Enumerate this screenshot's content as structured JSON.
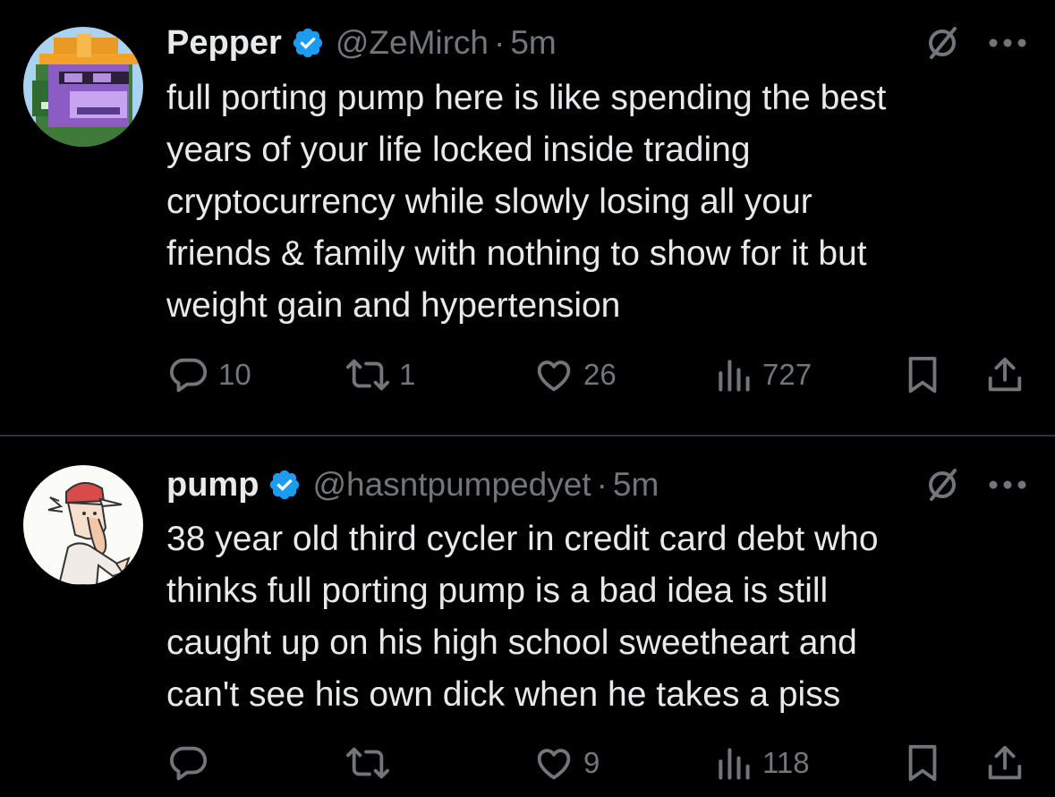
{
  "colors": {
    "background": "#000000",
    "text_primary": "#e7e9ea",
    "text_secondary": "#71767b",
    "verified_badge": "#1d9bf0",
    "divider": "#2f3336"
  },
  "tweets": [
    {
      "display_name": "Pepper",
      "handle": "@ZeMirch",
      "separator": "·",
      "time": "5m",
      "avatar_icon": "pixel-ape-avatar",
      "text_lines": [
        "full porting pump here is like spending the best",
        "years of your life locked inside trading",
        "cryptocurrency while slowly losing all your",
        "friends & family with nothing to show for it but",
        "weight gain and hypertension"
      ],
      "stats": {
        "replies": "10",
        "reposts": "1",
        "likes": "26",
        "views": "727"
      }
    },
    {
      "display_name": "pump",
      "handle": "@hasntpumpedyet",
      "separator": "·",
      "time": "5m",
      "avatar_icon": "cartoon-man-avatar",
      "text_lines": [
        "38 year old third cycler in credit card debt who",
        "thinks full porting pump is a bad idea is still",
        "caught up on his high school sweetheart and",
        "can't see his own dick when he takes a piss"
      ],
      "stats": {
        "replies": "",
        "reposts": "",
        "likes": "9",
        "views": "118"
      }
    }
  ]
}
